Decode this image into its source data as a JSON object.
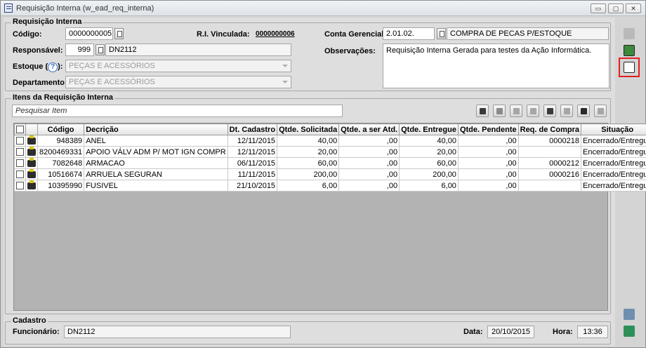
{
  "window": {
    "title": "Requisição Interna (w_ead_req_interna)",
    "buttons": [
      "▭",
      "▢",
      "✕"
    ]
  },
  "requisicao": {
    "group_title": "Requisição Interna",
    "codigo_label": "Código:",
    "codigo_value": "0000000005",
    "ri_vinculada_label": "R.I. Vinculada:",
    "ri_vinculada_value": "0000000006",
    "conta_gerencial_label": "Conta Gerencial:",
    "conta_gerencial_code": "2.01.02.",
    "conta_gerencial_desc": "COMPRA DE PECAS P/ESTOQUE",
    "responsavel_label": "Responsável:",
    "responsavel_code": "999",
    "responsavel_name": "DN2112",
    "observacoes_label": "Observações:",
    "observacoes_value": "Requisição Interna Gerada para testes da Ação Informática.",
    "estoque_label": "Estoque (",
    "estoque_help": "?",
    "estoque_label_end": "):",
    "estoque_value": "PEÇAS E ACESSÓRIOS",
    "departamento_label": "Departamento:",
    "departamento_value": "PEÇAS E ACESSÓRIOS"
  },
  "itens": {
    "group_title": "Itens da Requisição Interna",
    "search_placeholder": "Pesquisar Item",
    "columns": [
      "Código",
      "Decrição",
      "Dt. Cadastro",
      "Qtde. Solicitada",
      "Qtde. a ser Atd.",
      "Qtde. Entregue",
      "Qtde. Pendente",
      "Req. de Compra",
      "Situação"
    ],
    "rows": [
      {
        "codigo": "948389",
        "descricao": "ANEL",
        "dt_cadastro": "12/11/2015",
        "qtde_solicitada": "40,00",
        "qtde_atd": ",00",
        "qtde_entregue": "40,00",
        "qtde_pendente": ",00",
        "req_compra": "0000218",
        "situacao": "Encerrado/Entregue"
      },
      {
        "codigo": "8200469331",
        "descricao": "APOIO VÁLV ADM P/ MOT IGN COMPR",
        "dt_cadastro": "12/11/2015",
        "qtde_solicitada": "20,00",
        "qtde_atd": ",00",
        "qtde_entregue": "20,00",
        "qtde_pendente": ",00",
        "req_compra": "",
        "situacao": "Encerrado/Entregue"
      },
      {
        "codigo": "7082648",
        "descricao": "ARMACAO",
        "dt_cadastro": "06/11/2015",
        "qtde_solicitada": "60,00",
        "qtde_atd": ",00",
        "qtde_entregue": "60,00",
        "qtde_pendente": ",00",
        "req_compra": "0000212",
        "situacao": "Encerrado/Entregue"
      },
      {
        "codigo": "10516674",
        "descricao": "ARRUELA SEGURAN",
        "dt_cadastro": "11/11/2015",
        "qtde_solicitada": "200,00",
        "qtde_atd": ",00",
        "qtde_entregue": "200,00",
        "qtde_pendente": ",00",
        "req_compra": "0000216",
        "situacao": "Encerrado/Entregue"
      },
      {
        "codigo": "10395990",
        "descricao": "FUSIVEL",
        "dt_cadastro": "21/10/2015",
        "qtde_solicitada": "6,00",
        "qtde_atd": ",00",
        "qtde_entregue": "6,00",
        "qtde_pendente": ",00",
        "req_compra": "",
        "situacao": "Encerrado/Entregue"
      }
    ]
  },
  "cadastro": {
    "group_title": "Cadastro",
    "funcionario_label": "Funcionário:",
    "funcionario_value": "DN2112",
    "data_label": "Data:",
    "data_value": "20/10/2015",
    "hora_label": "Hora:",
    "hora_value": "13:36"
  },
  "colors": {
    "selected_outline": "#e02020",
    "window_bg": "#dedede",
    "grid_bg": "#b3b3b3"
  }
}
